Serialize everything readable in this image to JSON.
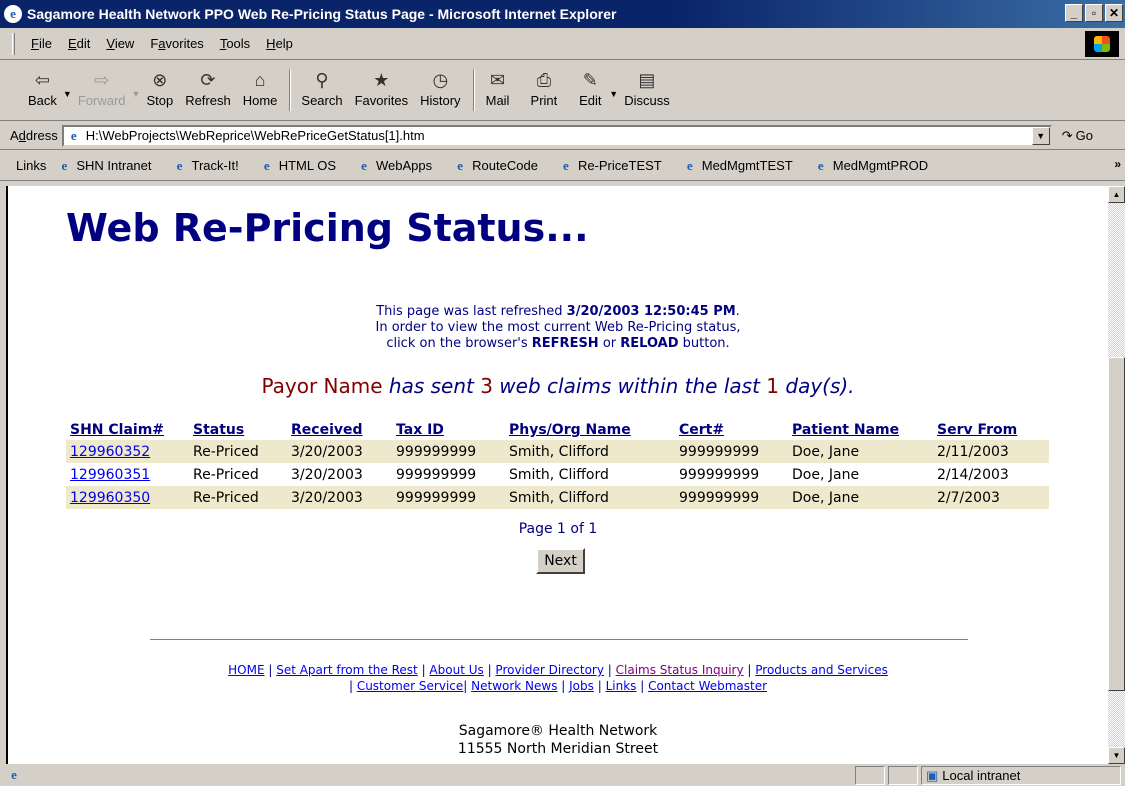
{
  "window": {
    "title": "Sagamore Health Network PPO Web Re-Pricing Status Page - Microsoft Internet Explorer",
    "buttons": [
      "_",
      "▫",
      "✕"
    ]
  },
  "menu": [
    {
      "key": "F",
      "rest": "ile"
    },
    {
      "key": "E",
      "rest": "dit"
    },
    {
      "key": "V",
      "rest": "iew"
    },
    {
      "pre": "F",
      "key": "a",
      "rest": "vorites"
    },
    {
      "key": "T",
      "rest": "ools"
    },
    {
      "key": "H",
      "rest": "elp"
    }
  ],
  "toolbar": {
    "back": "Back",
    "forward": "Forward",
    "stop": "Stop",
    "refresh": "Refresh",
    "home": "Home",
    "search": "Search",
    "favorites": "Favorites",
    "history": "History",
    "mail": "Mail",
    "print": "Print",
    "edit": "Edit",
    "discuss": "Discuss"
  },
  "address": {
    "label": "Address",
    "label_key": "d",
    "url": "H:\\WebProjects\\WebReprice\\WebRePriceGetStatus[1].htm",
    "go": "Go"
  },
  "links": {
    "label": "Links",
    "items": [
      "SHN Intranet",
      "Track-It!",
      "HTML OS",
      "WebApps",
      "RouteCode",
      "Re-PriceTEST",
      "MedMgmtTEST",
      "MedMgmtPROD"
    ]
  },
  "page": {
    "title": "Web Re-Pricing Status...",
    "refresh_line1_pre": "This page was last refreshed ",
    "refresh_time": "3/20/2003 12:50:45 PM",
    "refresh_line1_post": ".",
    "refresh_line2": "In order to view the most current Web Re-Pricing status,",
    "refresh_line3_pre": "click on the browser's ",
    "refresh_word": "REFRESH",
    "refresh_or": " or ",
    "reload_word": "RELOAD",
    "refresh_line3_post": " button.",
    "summary": {
      "payor": "Payor Name",
      "has_sent": " has sent ",
      "count": "3",
      "claims_within": " web claims within the last ",
      "days": "1",
      "days_suffix": " day(s)."
    },
    "table": {
      "headers": [
        "SHN Claim#",
        "Status",
        "Received",
        "Tax ID",
        "Phys/Org Name",
        "Cert#",
        "Patient Name",
        "Serv From"
      ],
      "rows": [
        [
          "129960352",
          "Re-Priced",
          "3/20/2003",
          "999999999",
          "Smith, Clifford",
          "999999999",
          "Doe, Jane",
          "2/11/2003"
        ],
        [
          "129960351",
          "Re-Priced",
          "3/20/2003",
          "999999999",
          "Smith, Clifford",
          "999999999",
          "Doe, Jane",
          "2/14/2003"
        ],
        [
          "129960350",
          "Re-Priced",
          "3/20/2003",
          "999999999",
          "Smith, Clifford",
          "999999999",
          "Doe, Jane",
          "2/7/2003"
        ]
      ]
    },
    "pager": "Page 1 of 1",
    "next_label": "Next",
    "footer_line1": [
      "HOME",
      "Set Apart from the Rest",
      "About Us",
      "Provider Directory",
      "Claims Status Inquiry",
      "Products and Services"
    ],
    "footer_line2": [
      "Customer Service",
      "Network News",
      "Jobs",
      "Links",
      "Contact Webmaster"
    ],
    "address_line1": "Sagamore® Health Network",
    "address_line2": "11555 North Meridian Street"
  },
  "status": {
    "zone": "Local intranet"
  },
  "colors": {
    "title_blue": "#000080",
    "row_highlight": "#eee9cc",
    "payor_red": "#800000"
  }
}
